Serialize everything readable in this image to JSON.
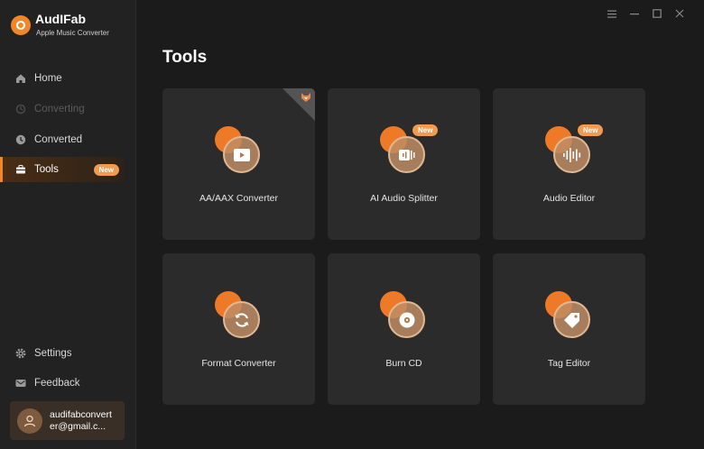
{
  "brand": {
    "name": "AudIFab",
    "subtitle": "Apple Music Converter"
  },
  "sidebar": {
    "items": [
      {
        "label": "Home",
        "icon": "home-icon",
        "state": "normal"
      },
      {
        "label": "Converting",
        "icon": "converting-icon",
        "state": "disabled"
      },
      {
        "label": "Converted",
        "icon": "clock-icon",
        "state": "normal"
      },
      {
        "label": "Tools",
        "icon": "toolbox-icon",
        "state": "active",
        "badge": "New"
      }
    ],
    "bottom": [
      {
        "label": "Settings",
        "icon": "gear-icon"
      },
      {
        "label": "Feedback",
        "icon": "mail-icon"
      }
    ],
    "account": {
      "email": "audifabconverter@gmail.c..."
    }
  },
  "window_controls": [
    "menu-icon",
    "minimize-icon",
    "maximize-icon",
    "close-icon"
  ],
  "main": {
    "title": "Tools",
    "tools": [
      {
        "label": "AA/AAX Converter",
        "icon": "play-icon",
        "badge": ""
      },
      {
        "label": "AI Audio Splitter",
        "icon": "audio-split-icon",
        "badge": "New"
      },
      {
        "label": "Audio Editor",
        "icon": "waveform-icon",
        "badge": "New"
      },
      {
        "label": "Format Converter",
        "icon": "refresh-icon",
        "badge": ""
      },
      {
        "label": "Burn CD",
        "icon": "disc-icon",
        "badge": ""
      },
      {
        "label": "Tag Editor",
        "icon": "tag-icon",
        "badge": ""
      }
    ]
  },
  "colors": {
    "accent": "#f0872a",
    "badge": "#f09a52",
    "card": "#2b2b2b",
    "sidebar": "#222222",
    "background": "#1b1b1b"
  }
}
